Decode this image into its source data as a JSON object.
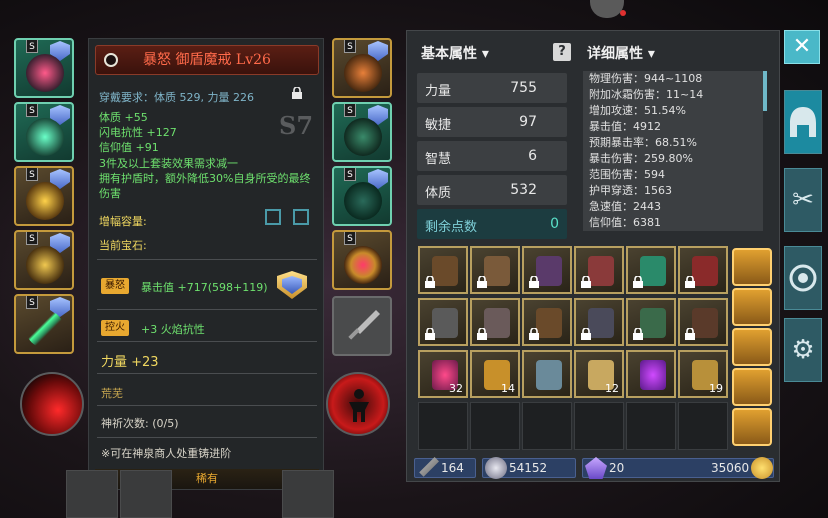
{
  "equipment_left": [
    {
      "slot": "helmet",
      "tag": "S",
      "color": "green"
    },
    {
      "slot": "armor",
      "tag": "S",
      "color": "green"
    },
    {
      "slot": "amulet",
      "tag": "S",
      "color": "gold"
    },
    {
      "slot": "ring",
      "tag": "S",
      "color": "gold"
    },
    {
      "slot": "weapon",
      "tag": "S",
      "color": "gold"
    }
  ],
  "equipment_right": [
    {
      "slot": "necklace",
      "tag": "S"
    },
    {
      "slot": "gloves",
      "tag": "S"
    },
    {
      "slot": "boots",
      "tag": "S"
    },
    {
      "slot": "ring2",
      "tag": "S"
    }
  ],
  "item": {
    "name": "暴怒 御盾魔戒 Lv26",
    "requirement": "穿戴要求：体质 529, 力量 226",
    "grade": "S7",
    "stats": [
      "体质 +55",
      "闪电抗性 +127",
      "信仰值 +91"
    ],
    "set_effect_1": "3件及以上套装效果需求减一",
    "set_effect_2": "拥有护盾时，额外降低30%自身所受的最终伤害",
    "capacity_label": "增幅容量:",
    "gem_label": "当前宝石:",
    "gem1_tag": "暴怒",
    "gem1_text": "暴击值 +717(598+119)",
    "gem2_tag": "控火",
    "gem2_text": "+3 火焰抗性",
    "strength_bonus": "力量 +23",
    "wasteland": "荒芜",
    "prayer": "神祈次数: (0/5)",
    "reforge_note": "※可在神泉商人处重铸进阶",
    "rarity": "稀有"
  },
  "basic": {
    "header": "基本属性",
    "rows": [
      {
        "label": "力量",
        "value": "755"
      },
      {
        "label": "敏捷",
        "value": "97"
      },
      {
        "label": "智慧",
        "value": "6"
      },
      {
        "label": "体质",
        "value": "532"
      }
    ],
    "remain_label": "剩余点数",
    "remain_value": "0"
  },
  "detail_attrs": {
    "header": "详细属性",
    "lines": [
      "物理伤害：944~1108",
      "附加冰霜伤害：11~14",
      "增加攻速：51.54%",
      "暴击值：4912",
      "预期暴击率：68.51%",
      "暴击伤害：259.80%",
      "范围伤害：594",
      "护甲穿透：1563",
      "急速值：2443",
      "信仰值：6381"
    ]
  },
  "inventory": {
    "row3_counts": [
      "32",
      "14",
      "",
      "12",
      "",
      "19"
    ]
  },
  "currency": {
    "sword": "164",
    "ore": "54152",
    "crystal": "20",
    "gold": "35060"
  },
  "colors": {
    "accent": "#4ab8c8",
    "item_name": "#ff6a4a",
    "stat_green": "#6ee16e",
    "gold": "#e8a830"
  },
  "icons": {
    "close": "✕",
    "skill_tab": "✂",
    "gear_tab": "⚙"
  }
}
